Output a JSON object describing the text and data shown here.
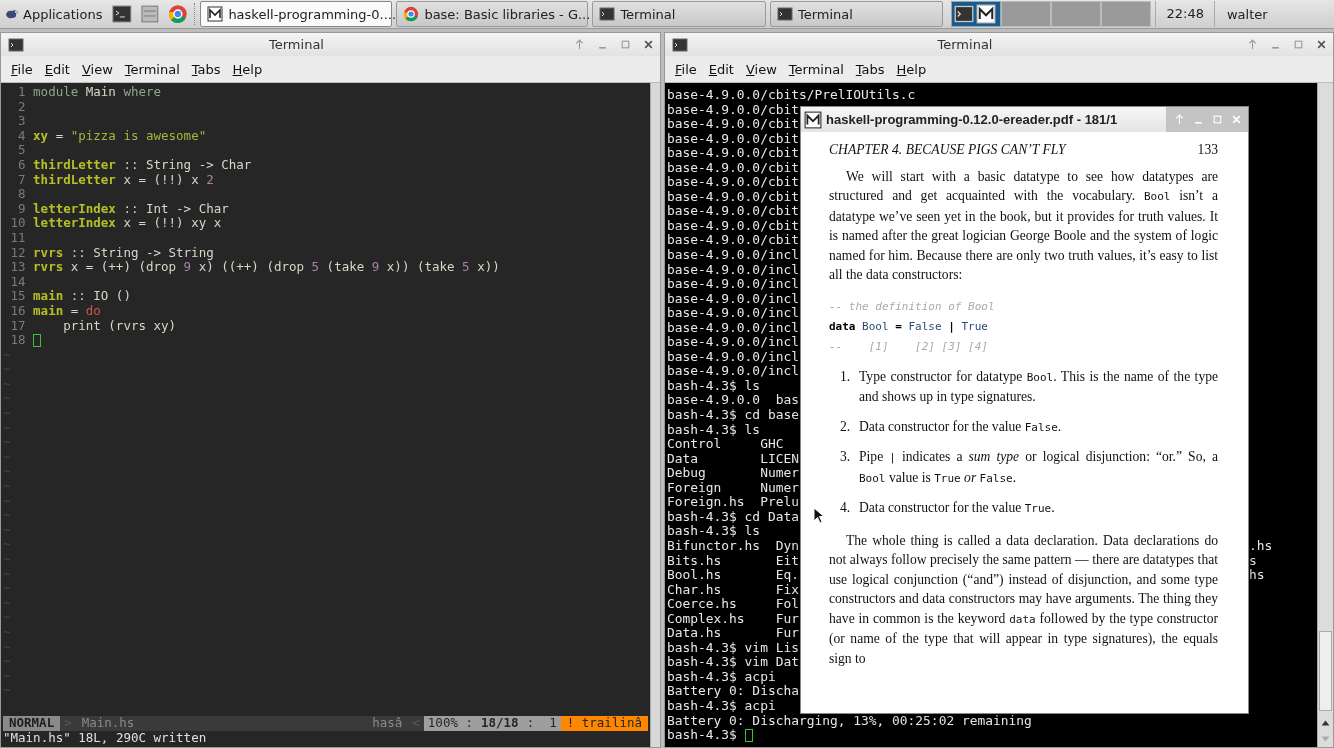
{
  "taskbar": {
    "apps_label": "Applications",
    "tasks": [
      {
        "label": "haskell-programming-0....",
        "kind": "document",
        "selected": true
      },
      {
        "label": "base: Basic libraries - G...",
        "kind": "browser",
        "selected": false
      },
      {
        "label": "Terminal",
        "kind": "terminal",
        "selected": false
      },
      {
        "label": "Terminal",
        "kind": "terminal",
        "selected": false
      }
    ],
    "workspaces": [
      {
        "selected": true
      },
      {
        "selected": false
      },
      {
        "selected": false
      },
      {
        "selected": false
      }
    ],
    "clock": "22:48",
    "user": "walter"
  },
  "left_window": {
    "title": "Terminal",
    "menu": [
      "File",
      "Edit",
      "View",
      "Terminal",
      "Tabs",
      "Help"
    ],
    "editor": {
      "lines": [
        {
          "number": "1",
          "cursor": false,
          "tokens": [
            {
              "text": "module",
              "kind": "kw"
            },
            {
              "text": " Main ",
              "kind": "plain"
            },
            {
              "text": "where",
              "kind": "kw"
            }
          ]
        },
        {
          "number": "2",
          "cursor": false
        },
        {
          "number": "3",
          "cursor": false
        },
        {
          "number": "4",
          "cursor": false,
          "tokens": [
            {
              "text": "xy",
              "kind": "def"
            },
            {
              "text": " = ",
              "kind": "plain"
            },
            {
              "text": "\"pizza is awesome\"",
              "kind": "str"
            }
          ]
        },
        {
          "number": "5",
          "cursor": false
        },
        {
          "number": "6",
          "cursor": false,
          "tokens": [
            {
              "text": "thirdLetter",
              "kind": "def"
            },
            {
              "text": " :: String -> Char",
              "kind": "plain"
            }
          ]
        },
        {
          "number": "7",
          "cursor": false,
          "tokens": [
            {
              "text": "thirdLetter",
              "kind": "def"
            },
            {
              "text": " x = (!!) x ",
              "kind": "plain"
            },
            {
              "text": "2",
              "kind": "num"
            }
          ]
        },
        {
          "number": "8",
          "cursor": false
        },
        {
          "number": "9",
          "cursor": false,
          "tokens": [
            {
              "text": "letterIndex",
              "kind": "def"
            },
            {
              "text": " :: Int -> Char",
              "kind": "plain"
            }
          ]
        },
        {
          "number": "10",
          "cursor": false,
          "tokens": [
            {
              "text": "letterIndex",
              "kind": "def"
            },
            {
              "text": " x = (!!) xy x",
              "kind": "plain"
            }
          ]
        },
        {
          "number": "11",
          "cursor": false
        },
        {
          "number": "12",
          "cursor": false,
          "tokens": [
            {
              "text": "rvrs",
              "kind": "def"
            },
            {
              "text": " :: String -> String",
              "kind": "plain"
            }
          ]
        },
        {
          "number": "13",
          "cursor": false,
          "tokens": [
            {
              "text": "rvrs",
              "kind": "def"
            },
            {
              "text": " x = (++) (drop ",
              "kind": "plain"
            },
            {
              "text": "9",
              "kind": "num"
            },
            {
              "text": " x) ((++) (drop ",
              "kind": "plain"
            },
            {
              "text": "5",
              "kind": "num"
            },
            {
              "text": " (take ",
              "kind": "plain"
            },
            {
              "text": "9",
              "kind": "num"
            },
            {
              "text": " x)) (take ",
              "kind": "plain"
            },
            {
              "text": "5",
              "kind": "num"
            },
            {
              "text": " x))",
              "kind": "plain"
            }
          ]
        },
        {
          "number": "14",
          "cursor": false
        },
        {
          "number": "15",
          "cursor": false,
          "tokens": [
            {
              "text": "main",
              "kind": "def"
            },
            {
              "text": " :: IO ()",
              "kind": "plain"
            }
          ]
        },
        {
          "number": "16",
          "cursor": false,
          "tokens": [
            {
              "text": "main",
              "kind": "def"
            },
            {
              "text": " = ",
              "kind": "plain"
            },
            {
              "text": "do",
              "kind": "ctl"
            }
          ]
        },
        {
          "number": "17",
          "cursor": false,
          "tokens": [
            {
              "text": "    print (rvrs xy)",
              "kind": "plain"
            }
          ]
        },
        {
          "number": "18",
          "cursor": true
        }
      ],
      "tildes": [
        "~",
        "~",
        "~",
        "~",
        "~",
        "~",
        "~",
        "~",
        "~",
        "~",
        "~",
        "~",
        "~",
        "~",
        "~",
        "~",
        "~",
        "~",
        "~",
        "~",
        "~",
        "~",
        "~",
        "~"
      ],
      "status_line": [
        {
          "text": "NORMAL",
          "kind": "mode"
        },
        {
          "text": ">",
          "kind": "sep"
        },
        {
          "text": "Main.hs",
          "kind": "file"
        },
        {
          "text": "hasâ",
          "kind": "filetype"
        },
        {
          "text": "<",
          "kind": "sep"
        },
        {
          "text": "100% :",
          "kind": "info"
        },
        {
          "text": "18/18",
          "kind": "infobold"
        },
        {
          "text": ":  1",
          "kind": "info"
        },
        {
          "text": "! trailinâ",
          "kind": "warn"
        }
      ],
      "message": "\"Main.hs\" 18L, 290C written"
    }
  },
  "right_window": {
    "title": "Terminal",
    "menu": [
      "File",
      "Edit",
      "View",
      "Terminal",
      "Tabs",
      "Help"
    ],
    "lines": [
      {
        "text": "base-4.9.0.0/cbits/PrelIOUtils.c"
      },
      {
        "text": "base-4.9.0.0/cbit"
      },
      {
        "text": "base-4.9.0.0/cbit"
      },
      {
        "text": "base-4.9.0.0/cbit"
      },
      {
        "text": "base-4.9.0.0/cbit"
      },
      {
        "text": "base-4.9.0.0/cbit"
      },
      {
        "text": "base-4.9.0.0/cbit"
      },
      {
        "text": "base-4.9.0.0/cbit"
      },
      {
        "text": "base-4.9.0.0/cbit"
      },
      {
        "text": "base-4.9.0.0/cbit"
      },
      {
        "text": "base-4.9.0.0/cbit"
      },
      {
        "text": "base-4.9.0.0/incl"
      },
      {
        "text": "base-4.9.0.0/incl"
      },
      {
        "text": "base-4.9.0.0/incl"
      },
      {
        "text": "base-4.9.0.0/incl"
      },
      {
        "text": "base-4.9.0.0/incl"
      },
      {
        "text": "base-4.9.0.0/incl"
      },
      {
        "text": "base-4.9.0.0/incl"
      },
      {
        "text": "base-4.9.0.0/incl"
      },
      {
        "text": "base-4.9.0.0/incl"
      },
      {
        "text": "bash-4.3$ ls"
      },
      {
        "text": "base-4.9.0.0  bas"
      },
      {
        "text": "bash-4.3$ cd base"
      },
      {
        "text": "bash-4.3$ ls"
      },
      {
        "text": "Control     GHC"
      },
      {
        "text": "Data        LICEN"
      },
      {
        "text": "Debug       Numer"
      },
      {
        "text": "Foreign     Numer"
      },
      {
        "text": "Foreign.hs  Prelu"
      },
      {
        "text": "bash-4.3$ cd Data"
      },
      {
        "text": "bash-4.3$ ls"
      },
      {
        "text": "Bifunctor.hs  Dyn",
        "tail": ".hs"
      },
      {
        "text": "Bits.hs       Eit",
        "tail": "s"
      },
      {
        "text": "Bool.hs       Eq.",
        "tail": "hs"
      },
      {
        "text": "Char.hs       Fix"
      },
      {
        "text": "Coerce.hs     Fol"
      },
      {
        "text": "Complex.hs    Fur"
      },
      {
        "text": "Data.hs       Fur"
      },
      {
        "text": "bash-4.3$ vim Lis"
      },
      {
        "text": "bash-4.3$ vim Dat"
      },
      {
        "text": "bash-4.3$ acpi"
      },
      {
        "text": "Battery 0: Discha"
      },
      {
        "text": "bash-4.3$ acpi"
      },
      {
        "text": "Battery 0: Discharging, 13%, 00:25:02 remaining"
      }
    ],
    "prompt": {
      "text": "bash-4.3$",
      "cursor": true
    }
  },
  "pdf_window": {
    "title": "haskell-programming-0.12.0-ereader.pdf - 181/1",
    "header": "CHAPTER 4.  BECAUSE PIGS CAN’T FLY",
    "page_number": "133",
    "blocks": [
      {
        "kind": "paragraph",
        "segments": [
          {
            "text": "We will start with a basic datatype to see how datatypes are structured and get acquainted with the vocabulary. ",
            "kind": "text"
          },
          {
            "text": "Bool",
            "kind": "code"
          },
          {
            "text": " isn’t a datatype we’ve seen yet in the book, but it provides for truth values. It is named after the great logician George Boole and the system of logic named for him.  Because there are only two truth values, it’s easy to list all the data constructors:",
            "kind": "text"
          }
        ]
      },
      {
        "kind": "code",
        "lines": [
          [
            {
              "text": "-- the definition of Bool",
              "kind": "comment"
            }
          ],
          [
            {
              "text": "data",
              "kind": "keyword"
            },
            {
              "text": " Bool ",
              "kind": "type"
            },
            {
              "text": "=",
              "kind": "keyword"
            },
            {
              "text": " False ",
              "kind": "type"
            },
            {
              "text": "|",
              "kind": "keyword"
            },
            {
              "text": " True",
              "kind": "type"
            }
          ],
          [
            {
              "text": "--    [1]    [2] [3] [4]",
              "kind": "comment"
            }
          ]
        ]
      },
      {
        "kind": "list",
        "items": [
          {
            "number": "1.",
            "segments": [
              {
                "text": "Type constructor for datatype ",
                "kind": "text"
              },
              {
                "text": "Bool",
                "kind": "code"
              },
              {
                "text": ". This is the name of the type and shows up in type signatures.",
                "kind": "text"
              }
            ]
          },
          {
            "number": "2.",
            "segments": [
              {
                "text": "Data constructor for the value ",
                "kind": "text"
              },
              {
                "text": "False",
                "kind": "code"
              },
              {
                "text": ".",
                "kind": "text"
              }
            ]
          },
          {
            "number": "3.",
            "segments": [
              {
                "text": "Pipe ",
                "kind": "text"
              },
              {
                "text": "|",
                "kind": "code"
              },
              {
                "text": " indicates a ",
                "kind": "text"
              },
              {
                "text": "sum type",
                "kind": "em"
              },
              {
                "text": " or logical disjunction: “or.” So, a ",
                "kind": "text"
              },
              {
                "text": "Bool",
                "kind": "code"
              },
              {
                "text": " value is ",
                "kind": "text"
              },
              {
                "text": "True",
                "kind": "code"
              },
              {
                "text": " or ",
                "kind": "em"
              },
              {
                "text": "False",
                "kind": "code"
              },
              {
                "text": ".",
                "kind": "text"
              }
            ]
          },
          {
            "number": "4.",
            "segments": [
              {
                "text": "Data constructor for the value ",
                "kind": "text"
              },
              {
                "text": "True",
                "kind": "code"
              },
              {
                "text": ".",
                "kind": "text"
              }
            ]
          }
        ]
      },
      {
        "kind": "paragraph",
        "segments": [
          {
            "text": "The whole thing is called a data declaration. Data declarations do not always follow precisely the same pattern — there are datatypes that use logical conjunction (“and”) instead of disjunction, and some type constructors and data constructors may have arguments. The thing they have in common is the keyword ",
            "kind": "text"
          },
          {
            "text": "data",
            "kind": "code"
          },
          {
            "text": " followed by the type constructor (or name of the type that will appear in type signatures), the equals sign to",
            "kind": "text"
          }
        ]
      }
    ]
  }
}
